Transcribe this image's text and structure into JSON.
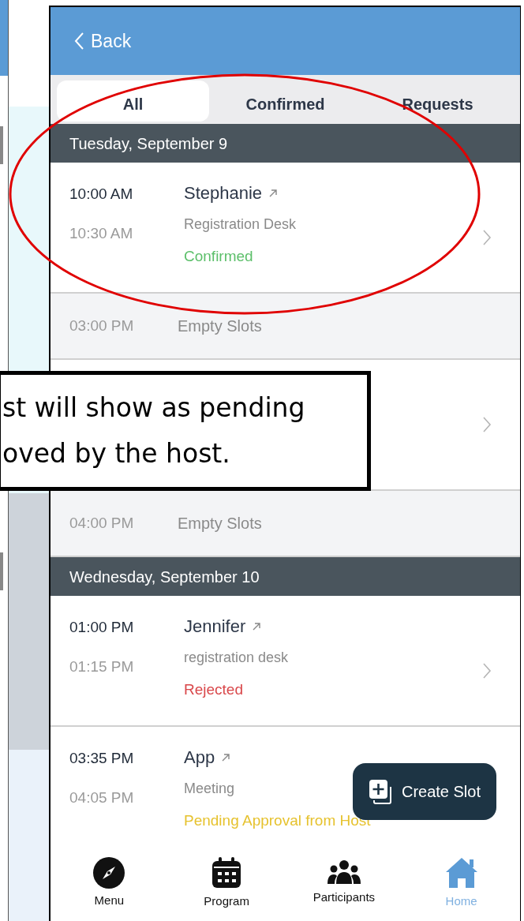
{
  "header": {
    "back_label": "Back"
  },
  "tabs": [
    {
      "label": "All",
      "selected": true
    },
    {
      "label": "Confirmed",
      "selected": false
    },
    {
      "label": "Requests",
      "selected": false
    }
  ],
  "days": [
    {
      "date": "Tuesday, September 9",
      "slots": [
        {
          "kind": "booking",
          "start": "10:00 AM",
          "end": "10:30 AM",
          "name": "Stephanie",
          "location": "Registration Desk",
          "status": "Confirmed",
          "color": "#5cbf6a"
        },
        {
          "kind": "empty",
          "start": "03:00 PM",
          "label": "Empty Slots"
        },
        {
          "kind": "hidden"
        },
        {
          "kind": "empty",
          "start": "04:00 PM",
          "label": "Empty Slots"
        }
      ]
    },
    {
      "date": "Wednesday, September 10",
      "slots": [
        {
          "kind": "booking",
          "start": "01:00 PM",
          "end": "01:15 PM",
          "name": "Jennifer",
          "location": "registration desk",
          "status": "Rejected",
          "color": "#d9474a"
        },
        {
          "kind": "booking",
          "start": "03:35 PM",
          "end": "04:05 PM",
          "name": "App",
          "location": "Meeting",
          "status": "Pending Approval from Host",
          "color": "#e6c22e"
        }
      ]
    }
  ],
  "create_button": {
    "label": "Create Slot"
  },
  "nav": [
    {
      "label": "Menu",
      "selected": false
    },
    {
      "label": "Program",
      "selected": false
    },
    {
      "label": "Participants",
      "selected": false
    },
    {
      "label": "Home",
      "selected": true
    }
  ],
  "callout": {
    "lines": [
      "st will show as pending",
      "oved by the host."
    ]
  }
}
